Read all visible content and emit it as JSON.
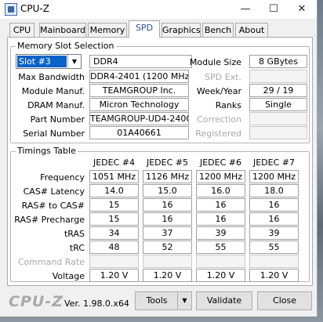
{
  "window": {
    "title": "CPU-Z",
    "minimize": "—",
    "maximize": "☐",
    "close": "✕"
  },
  "tabs": [
    "CPU",
    "Mainboard",
    "Memory",
    "SPD",
    "Graphics",
    "Bench",
    "About"
  ],
  "slot_group": {
    "title": "Memory Slot Selection",
    "slot_value": "Slot #3",
    "type_value": "DDR4",
    "module_size_label": "Module Size",
    "module_size_value": "8 GBytes",
    "max_bw_label": "Max Bandwidth",
    "max_bw_value": "DDR4-2401 (1200 MHz)",
    "spd_ext_label": "SPD Ext.",
    "module_manuf_label": "Module Manuf.",
    "module_manuf_value": "TEAMGROUP Inc.",
    "week_year_label": "Week/Year",
    "week_year_value": "29 / 19",
    "dram_manuf_label": "DRAM Manuf.",
    "dram_manuf_value": "Micron Technology",
    "ranks_label": "Ranks",
    "ranks_value": "Single",
    "part_label": "Part Number",
    "part_value": "TEAMGROUP-UD4-2400",
    "correction_label": "Correction",
    "serial_label": "Serial Number",
    "serial_value": "01A40661",
    "registered_label": "Registered"
  },
  "timings": {
    "title": "Timings Table",
    "columns": [
      "JEDEC #4",
      "JEDEC #5",
      "JEDEC #6",
      "JEDEC #7"
    ],
    "rows": [
      {
        "label": "Frequency",
        "values": [
          "1051 MHz",
          "1126 MHz",
          "1200 MHz",
          "1200 MHz"
        ]
      },
      {
        "label": "CAS# Latency",
        "values": [
          "14.0",
          "15.0",
          "16.0",
          "18.0"
        ]
      },
      {
        "label": "RAS# to CAS#",
        "values": [
          "15",
          "16",
          "16",
          "16"
        ]
      },
      {
        "label": "RAS# Precharge",
        "values": [
          "15",
          "16",
          "16",
          "16"
        ]
      },
      {
        "label": "tRAS",
        "values": [
          "34",
          "37",
          "39",
          "39"
        ]
      },
      {
        "label": "tRC",
        "values": [
          "48",
          "52",
          "55",
          "55"
        ]
      },
      {
        "label": "Command Rate",
        "values": [
          "",
          "",
          "",
          ""
        ],
        "disabled": true
      },
      {
        "label": "Voltage",
        "values": [
          "1.20 V",
          "1.20 V",
          "1.20 V",
          "1.20 V"
        ]
      }
    ]
  },
  "footer": {
    "logo": "CPU-Z",
    "version": "Ver. 1.98.0.x64",
    "tools_label": "Tools",
    "validate_label": "Validate",
    "close_label": "Close"
  }
}
